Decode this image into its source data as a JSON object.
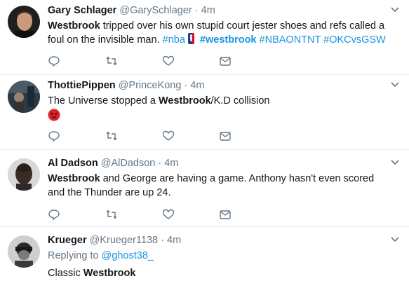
{
  "tweets": [
    {
      "name": "Gary Schlager",
      "handle": "@GarySchlager",
      "sep": "·",
      "time": "4m",
      "text_bold1": "Westbrook",
      "text_rest": " tripped over his own stupid court jester shoes and refs called a foul on the invisible man. ",
      "hashtags": [
        "#nba",
        "#westbrook",
        "#NBAONTNT",
        "#OKCvsGSW"
      ]
    },
    {
      "name": "ThottiePippen",
      "handle": "@PrinceKong",
      "sep": "·",
      "time": "4m",
      "text_pre": "The Universe stopped a ",
      "text_bold1": "Westbrook",
      "text_rest": "/K.D collision",
      "emoji": "angry-face"
    },
    {
      "name": "Al Dadson",
      "handle": "@AlDadson",
      "sep": "·",
      "time": "4m",
      "text_bold1": "Westbrook",
      "text_rest": " and George are having a game. Anthony hasn't even scored and the Thunder are up 24."
    },
    {
      "name": "Krueger",
      "handle": "@Krueger1138",
      "sep": "·",
      "time": "4m",
      "replying_label": "Replying to ",
      "replying_handle": "@ghost38_",
      "text_pre": "Classic ",
      "text_bold1": "Westbrook"
    }
  ],
  "colors": {
    "link": "#1b95e0",
    "muted": "#657786",
    "divider": "#e6ecf0",
    "icon": "#657786"
  },
  "icons": [
    "reply-icon",
    "retweet-icon",
    "like-icon",
    "direct-message-icon",
    "caret-down-icon"
  ]
}
